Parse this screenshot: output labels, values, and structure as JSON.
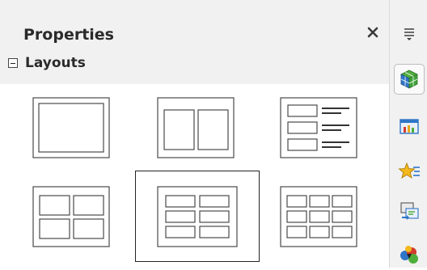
{
  "panel": {
    "title": "Properties",
    "close_glyph": "✕",
    "section": {
      "title": "Layouts",
      "expanded": true
    },
    "layouts": [
      {
        "name": "blank"
      },
      {
        "name": "two-content"
      },
      {
        "name": "content-with-text"
      },
      {
        "name": "four-content"
      },
      {
        "name": "six-content",
        "selected": true
      },
      {
        "name": "nine-content"
      }
    ]
  },
  "deck": {
    "menu_icon": "deck-menu-icon",
    "items": [
      {
        "icon": "properties-cube-icon",
        "active": true
      },
      {
        "icon": "master-slides-icon"
      },
      {
        "icon": "animation-star-icon"
      },
      {
        "icon": "slide-transition-icon"
      },
      {
        "icon": "gallery-icon"
      }
    ]
  },
  "colors": {
    "panel_bg": "#f1f1f1",
    "layout_area_bg": "#ffffff",
    "thumb_stroke": "#4a4a4a",
    "selection_border": "#222222",
    "cube_blue": "#2e75c7",
    "cube_green": "#4fae3b",
    "star_yellow": "#f2b81c"
  }
}
